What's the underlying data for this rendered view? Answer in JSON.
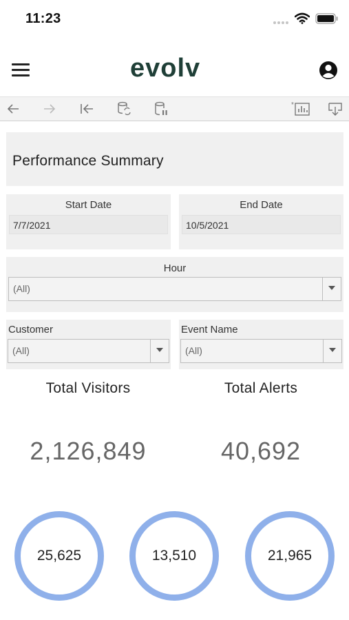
{
  "status_bar": {
    "time": "11:23"
  },
  "header": {
    "logo": "evolv"
  },
  "dashboard": {
    "title": "Performance Summary",
    "filters": {
      "start_date": {
        "label": "Start Date",
        "value": "7/7/2021"
      },
      "end_date": {
        "label": "End Date",
        "value": "10/5/2021"
      },
      "hour": {
        "label": "Hour",
        "value": "(All)"
      },
      "customer": {
        "label": "Customer",
        "value": "(All)"
      },
      "event_name": {
        "label": "Event Name",
        "value": "(All)"
      }
    },
    "kpis": {
      "total_visitors": {
        "label": "Total Visitors",
        "value": "2,126,849"
      },
      "total_alerts": {
        "label": "Total Alerts",
        "value": "40,692"
      }
    },
    "rings": [
      "25,625",
      "13,510",
      "21,965"
    ],
    "ring_color": "#8fb0ea"
  },
  "icons": {
    "toolbar": [
      "arrow-left-icon",
      "arrow-right-icon",
      "revert-icon",
      "refresh-icon",
      "pause-updates-icon",
      "metrics-icon",
      "download-icon"
    ],
    "header": [
      "menu-icon",
      "account-icon"
    ]
  }
}
